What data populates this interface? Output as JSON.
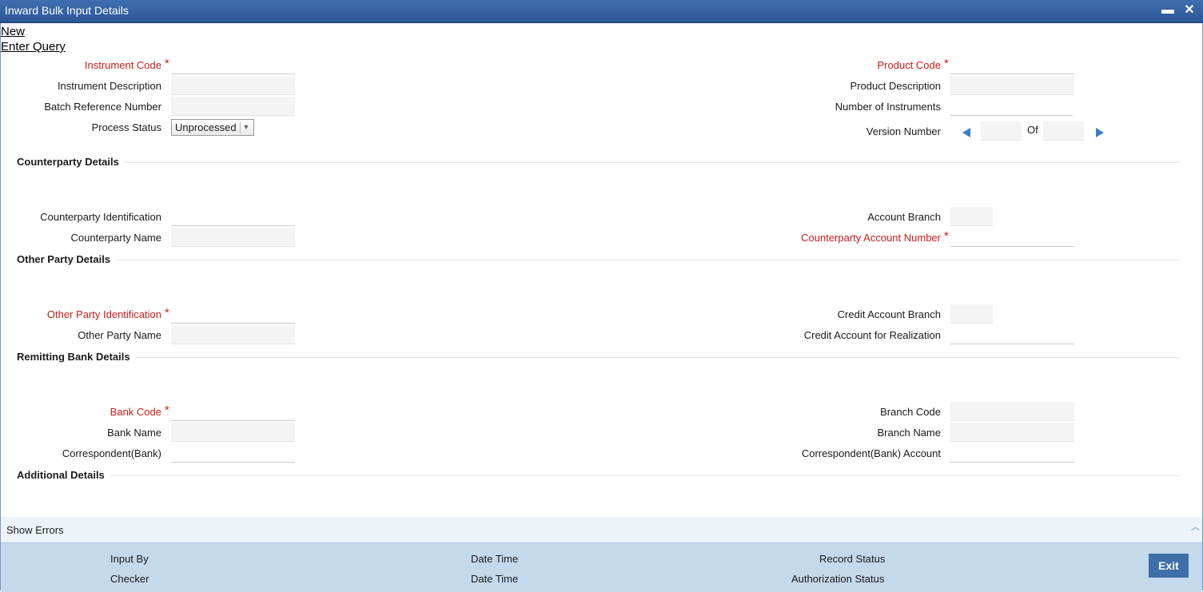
{
  "window": {
    "title": "Inward Bulk Input Details",
    "minimize": "▬",
    "close": "✕"
  },
  "menu": {
    "new": "New",
    "enter_query": "Enter Query"
  },
  "header": {
    "instrument_code": "Instrument Code",
    "instrument_description": "Instrument Description",
    "batch_reference_number": "Batch Reference Number",
    "process_status": "Process Status",
    "process_status_value": "Unprocessed",
    "product_code": "Product Code",
    "product_description": "Product Description",
    "number_of_instruments": "Number of Instruments",
    "version_number": "Version Number",
    "of": "Of",
    "required_mark": "*"
  },
  "counterparty": {
    "title": "Counterparty Details",
    "identification": "Counterparty Identification",
    "name": "Counterparty Name",
    "account_branch": "Account Branch",
    "account_number": "Counterparty Account Number"
  },
  "other_party": {
    "title": "Other Party Details",
    "identification": "Other Party Identification",
    "name": "Other Party Name",
    "credit_account_branch": "Credit Account Branch",
    "credit_account_realization": "Credit Account for Realization"
  },
  "remitting_bank": {
    "title": "Remitting Bank Details",
    "bank_code": "Bank Code",
    "bank_name": "Bank Name",
    "correspondent": "Correspondent(Bank)",
    "branch_code": "Branch Code",
    "branch_name": "Branch Name",
    "correspondent_account": "Correspondent(Bank) Account"
  },
  "additional": {
    "title": "Additional Details"
  },
  "errors": {
    "label": "Show Errors",
    "toggle_icon": "︿"
  },
  "footer": {
    "input_by": "Input By",
    "checker": "Checker",
    "date_time_1": "Date Time",
    "date_time_2": "Date Time",
    "record_status": "Record Status",
    "authorization_status": "Authorization Status",
    "exit": "Exit"
  },
  "colors": {
    "titlebar": "#2f5d9f",
    "required": "#cc1b1b",
    "footer": "#c5d9ed",
    "exit_button": "#3d6fa8"
  }
}
